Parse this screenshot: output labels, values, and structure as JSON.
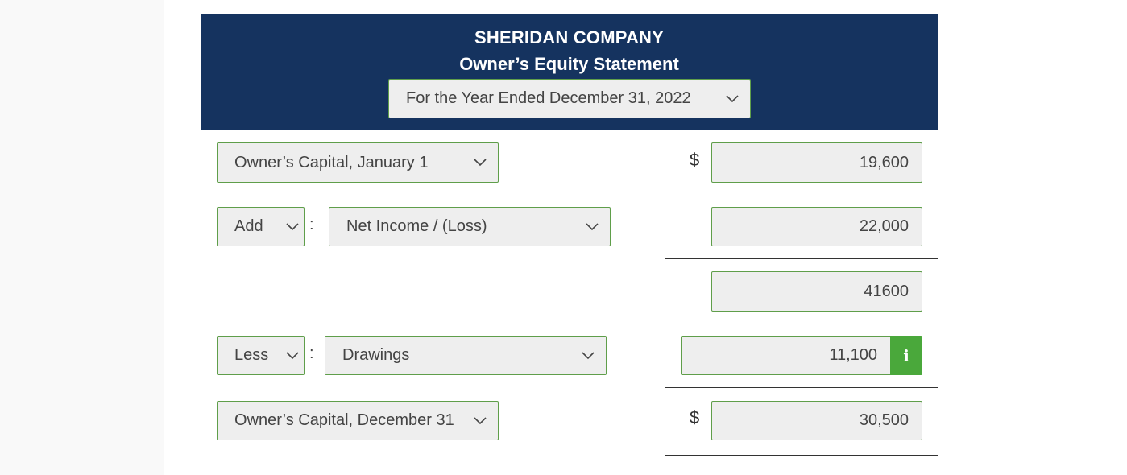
{
  "header": {
    "company": "SHERIDAN COMPANY",
    "title": "Owner’s Equity Statement",
    "period": "For the Year Ended December 31, 2022"
  },
  "rows": {
    "beginning": {
      "label": "Owner’s Capital, January 1",
      "currency": "$",
      "amount": "19,600"
    },
    "add": {
      "operator": "Add",
      "separator": ":",
      "label": "Net Income / (Loss)",
      "amount": "22,000"
    },
    "subtotal": {
      "amount": "41600"
    },
    "less": {
      "operator": "Less",
      "separator": ":",
      "label": "Drawings",
      "amount": "11,100",
      "info_icon": "info-icon"
    },
    "ending": {
      "label": "Owner’s Capital, December 31",
      "currency": "$",
      "amount": "30,500"
    }
  },
  "colors": {
    "header_bg": "#15335f",
    "field_border": "#5f9e4a",
    "field_bg": "#eeeeee",
    "info_button": "#4aa83b"
  }
}
